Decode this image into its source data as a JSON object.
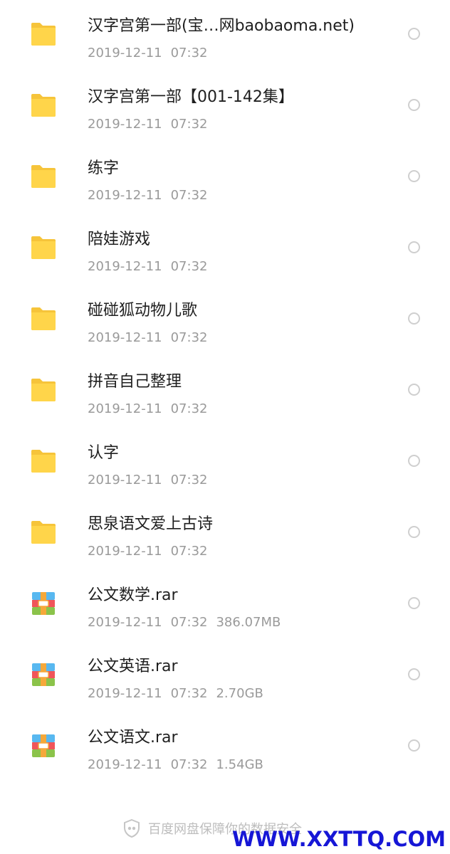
{
  "colors": {
    "folder": "#FFD54A",
    "folder_tab": "#F6C43A",
    "meta_text": "#9a9a9a",
    "name_text": "#1f1f1f",
    "check_border": "#cfcfcf",
    "watermark": "#1616d6",
    "archive_blue": "#58B8F0",
    "archive_red": "#F0555A",
    "archive_green": "#8BC34A",
    "archive_band": "#F5A83A"
  },
  "files": [
    {
      "name": "汉字宫第一部(宝…网baobaoma.net)",
      "date": "2019-12-11",
      "time": "07:32",
      "size": "",
      "icon": "folder-icon"
    },
    {
      "name": "汉字宫第一部【001-142集】",
      "date": "2019-12-11",
      "time": "07:32",
      "size": "",
      "icon": "folder-icon"
    },
    {
      "name": "练字",
      "date": "2019-12-11",
      "time": "07:32",
      "size": "",
      "icon": "folder-icon"
    },
    {
      "name": "陪娃游戏",
      "date": "2019-12-11",
      "time": "07:32",
      "size": "",
      "icon": "folder-icon"
    },
    {
      "name": "碰碰狐动物儿歌",
      "date": "2019-12-11",
      "time": "07:32",
      "size": "",
      "icon": "folder-icon"
    },
    {
      "name": "拼音自己整理",
      "date": "2019-12-11",
      "time": "07:32",
      "size": "",
      "icon": "folder-icon"
    },
    {
      "name": "认字",
      "date": "2019-12-11",
      "time": "07:32",
      "size": "",
      "icon": "folder-icon"
    },
    {
      "name": "思泉语文爱上古诗",
      "date": "2019-12-11",
      "time": "07:32",
      "size": "",
      "icon": "folder-icon"
    },
    {
      "name": "公文数学.rar",
      "date": "2019-12-11",
      "time": "07:32",
      "size": "386.07MB",
      "icon": "archive-icon"
    },
    {
      "name": "公文英语.rar",
      "date": "2019-12-11",
      "time": "07:32",
      "size": "2.70GB",
      "icon": "archive-icon"
    },
    {
      "name": "公文语文.rar",
      "date": "2019-12-11",
      "time": "07:32",
      "size": "1.54GB",
      "icon": "archive-icon"
    }
  ],
  "footer": {
    "text": "百度网盘保障你的数据安全",
    "icon": "shield-icon"
  },
  "watermark": {
    "text": "WWW.XXTTQ.COM"
  }
}
